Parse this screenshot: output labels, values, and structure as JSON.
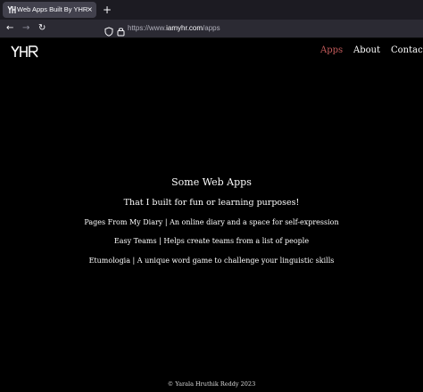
{
  "browser": {
    "tab_title": "Web Apps Built By YHR",
    "tab_close": "×",
    "new_tab": "+",
    "back": "←",
    "forward": "→",
    "reload": "↻",
    "url_prefix": "https://www.",
    "url_domain": "iamyhr.com",
    "url_path": "/apps"
  },
  "site": {
    "logo_text": "YHR",
    "nav": [
      {
        "label": "Apps",
        "active": true
      },
      {
        "label": "About",
        "active": false
      },
      {
        "label": "Contact",
        "active": false
      }
    ],
    "accent_color": "#c25a5a",
    "heading": "Some Web Apps",
    "subheading": "That I built for fun or learning purposes!",
    "apps": [
      "Pages From My Diary | An online diary and a space for self-expression",
      "Easy Teams | Helps create teams from a list of people",
      "Etumologia | A unique word game to challenge your linguistic skills"
    ],
    "footer": "© Yarala Hruthik Reddy 2023"
  }
}
